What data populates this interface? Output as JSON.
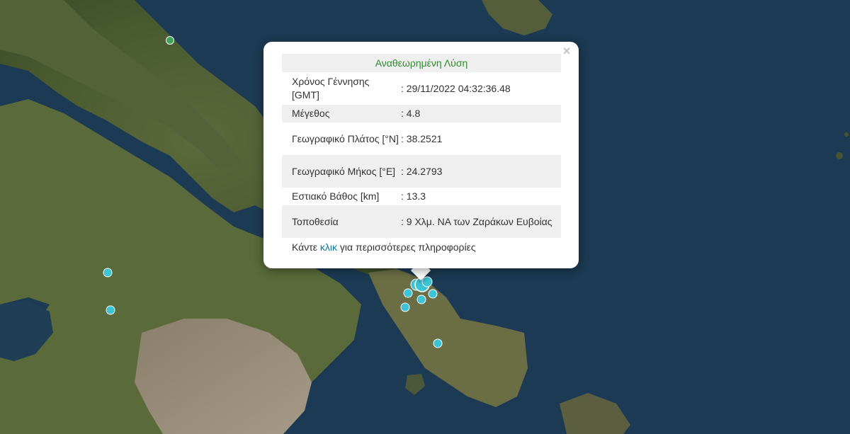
{
  "popup": {
    "title": "Αναθεωρημένη Λύση",
    "close_label": "×",
    "rows": [
      {
        "label": "Χρόνος Γέννησης [GMT]",
        "value": ": 29/11/2022 04:32:36.48"
      },
      {
        "label": "Μέγεθος",
        "value": ": 4.8"
      },
      {
        "label": "Γεωγραφικό Πλάτος [°N]",
        "value": ": 38.2521"
      },
      {
        "label": "Γεωγραφικό Μήκος [°E]",
        "value": ": 24.2793"
      },
      {
        "label": "Εστιακό Βάθος [km]",
        "value": ": 13.3"
      },
      {
        "label": "Τοποθεσία",
        "value": ": 9 Χλμ. ΝΑ των Ζαράκων Ευβοίας"
      }
    ],
    "more_prefix": "Κάντε ",
    "more_link": "κλικ",
    "more_suffix": " για περισσότερες πληροφορίες"
  },
  "colors": {
    "sea": "#1d3a52",
    "land": "#4a5a32",
    "marker_cyan": "#3cc4d4",
    "marker_green": "#3fa35a",
    "title_green": "#2e8b2e",
    "link_blue": "#0078a8"
  },
  "markers": {
    "green_count": 1,
    "cyan_count": 10
  }
}
